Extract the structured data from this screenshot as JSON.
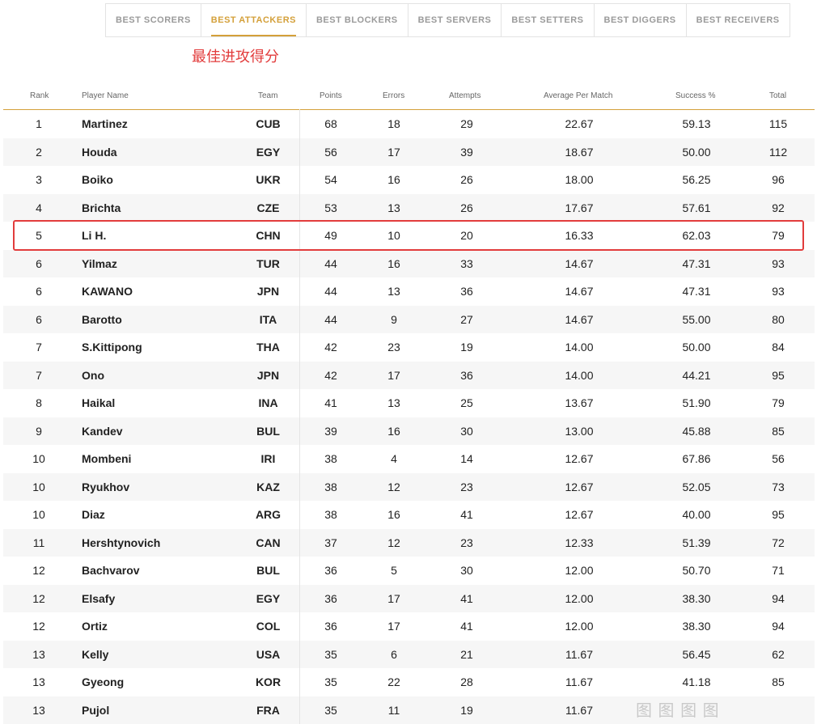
{
  "tabs": [
    {
      "label": "BEST SCORERS",
      "active": false
    },
    {
      "label": "BEST ATTACKERS",
      "active": true
    },
    {
      "label": "BEST BLOCKERS",
      "active": false
    },
    {
      "label": "BEST SERVERS",
      "active": false
    },
    {
      "label": "BEST SETTERS",
      "active": false
    },
    {
      "label": "BEST DIGGERS",
      "active": false
    },
    {
      "label": "BEST RECEIVERS",
      "active": false
    }
  ],
  "annotation": "最佳进攻得分",
  "columns": {
    "rank": "Rank",
    "player": "Player Name",
    "team": "Team",
    "points": "Points",
    "errors": "Errors",
    "attempts": "Attempts",
    "avg": "Average Per Match",
    "success": "Success %",
    "total": "Total"
  },
  "rows": [
    {
      "rank": "1",
      "name": "Martinez",
      "team": "CUB",
      "points": "68",
      "errors": "18",
      "attempts": "29",
      "avg": "22.67",
      "success": "59.13",
      "total": "115"
    },
    {
      "rank": "2",
      "name": "Houda",
      "team": "EGY",
      "points": "56",
      "errors": "17",
      "attempts": "39",
      "avg": "18.67",
      "success": "50.00",
      "total": "112"
    },
    {
      "rank": "3",
      "name": "Boiko",
      "team": "UKR",
      "points": "54",
      "errors": "16",
      "attempts": "26",
      "avg": "18.00",
      "success": "56.25",
      "total": "96"
    },
    {
      "rank": "4",
      "name": "Brichta",
      "team": "CZE",
      "points": "53",
      "errors": "13",
      "attempts": "26",
      "avg": "17.67",
      "success": "57.61",
      "total": "92"
    },
    {
      "rank": "5",
      "name": "Li H.",
      "team": "CHN",
      "points": "49",
      "errors": "10",
      "attempts": "20",
      "avg": "16.33",
      "success": "62.03",
      "total": "79"
    },
    {
      "rank": "6",
      "name": "Yilmaz",
      "team": "TUR",
      "points": "44",
      "errors": "16",
      "attempts": "33",
      "avg": "14.67",
      "success": "47.31",
      "total": "93"
    },
    {
      "rank": "6",
      "name": "KAWANO",
      "team": "JPN",
      "points": "44",
      "errors": "13",
      "attempts": "36",
      "avg": "14.67",
      "success": "47.31",
      "total": "93"
    },
    {
      "rank": "6",
      "name": "Barotto",
      "team": "ITA",
      "points": "44",
      "errors": "9",
      "attempts": "27",
      "avg": "14.67",
      "success": "55.00",
      "total": "80"
    },
    {
      "rank": "7",
      "name": "S.Kittipong",
      "team": "THA",
      "points": "42",
      "errors": "23",
      "attempts": "19",
      "avg": "14.00",
      "success": "50.00",
      "total": "84"
    },
    {
      "rank": "7",
      "name": "Ono",
      "team": "JPN",
      "points": "42",
      "errors": "17",
      "attempts": "36",
      "avg": "14.00",
      "success": "44.21",
      "total": "95"
    },
    {
      "rank": "8",
      "name": "Haikal",
      "team": "INA",
      "points": "41",
      "errors": "13",
      "attempts": "25",
      "avg": "13.67",
      "success": "51.90",
      "total": "79"
    },
    {
      "rank": "9",
      "name": "Kandev",
      "team": "BUL",
      "points": "39",
      "errors": "16",
      "attempts": "30",
      "avg": "13.00",
      "success": "45.88",
      "total": "85"
    },
    {
      "rank": "10",
      "name": "Mombeni",
      "team": "IRI",
      "points": "38",
      "errors": "4",
      "attempts": "14",
      "avg": "12.67",
      "success": "67.86",
      "total": "56"
    },
    {
      "rank": "10",
      "name": "Ryukhov",
      "team": "KAZ",
      "points": "38",
      "errors": "12",
      "attempts": "23",
      "avg": "12.67",
      "success": "52.05",
      "total": "73"
    },
    {
      "rank": "10",
      "name": "Diaz",
      "team": "ARG",
      "points": "38",
      "errors": "16",
      "attempts": "41",
      "avg": "12.67",
      "success": "40.00",
      "total": "95"
    },
    {
      "rank": "11",
      "name": "Hershtynovich",
      "team": "CAN",
      "points": "37",
      "errors": "12",
      "attempts": "23",
      "avg": "12.33",
      "success": "51.39",
      "total": "72"
    },
    {
      "rank": "12",
      "name": "Bachvarov",
      "team": "BUL",
      "points": "36",
      "errors": "5",
      "attempts": "30",
      "avg": "12.00",
      "success": "50.70",
      "total": "71"
    },
    {
      "rank": "12",
      "name": "Elsafy",
      "team": "EGY",
      "points": "36",
      "errors": "17",
      "attempts": "41",
      "avg": "12.00",
      "success": "38.30",
      "total": "94"
    },
    {
      "rank": "12",
      "name": "Ortiz",
      "team": "COL",
      "points": "36",
      "errors": "17",
      "attempts": "41",
      "avg": "12.00",
      "success": "38.30",
      "total": "94"
    },
    {
      "rank": "13",
      "name": "Kelly",
      "team": "USA",
      "points": "35",
      "errors": "6",
      "attempts": "21",
      "avg": "11.67",
      "success": "56.45",
      "total": "62"
    },
    {
      "rank": "13",
      "name": "Gyeong",
      "team": "KOR",
      "points": "35",
      "errors": "22",
      "attempts": "28",
      "avg": "11.67",
      "success": "41.18",
      "total": "85"
    },
    {
      "rank": "13",
      "name": "Pujol",
      "team": "FRA",
      "points": "35",
      "errors": "11",
      "attempts": "19",
      "avg": "11.67",
      "success": "",
      "total": ""
    }
  ],
  "colors": {
    "accent": "#d4a03a",
    "highlight": "#e23c3c"
  },
  "watermark": "图 图 图 图"
}
